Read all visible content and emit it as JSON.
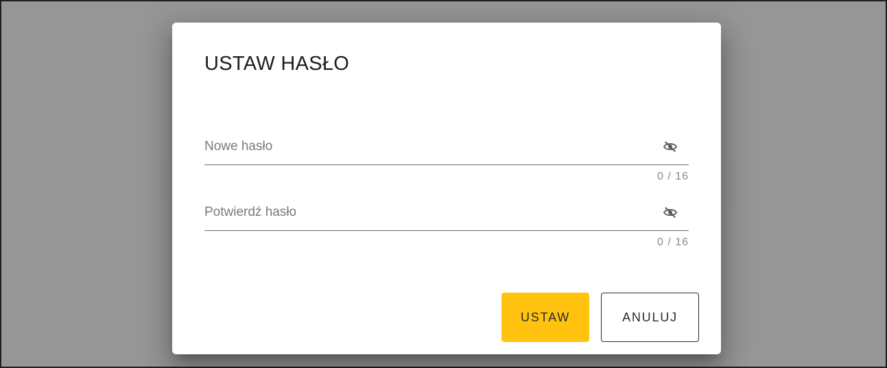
{
  "dialog": {
    "title": "USTAW HASŁO",
    "fields": [
      {
        "label": "Nowe hasło",
        "value": "",
        "counter": "0 / 16",
        "visibility_icon": "eye-off-icon"
      },
      {
        "label": "Potwierdź hasło",
        "value": "",
        "counter": "0 / 16",
        "visibility_icon": "eye-off-icon"
      }
    ],
    "actions": {
      "confirm_label": "USTAW",
      "cancel_label": "ANULUJ"
    }
  },
  "colors": {
    "backdrop": "#969696",
    "primary_button": "#ffc20e",
    "surface": "#ffffff"
  }
}
